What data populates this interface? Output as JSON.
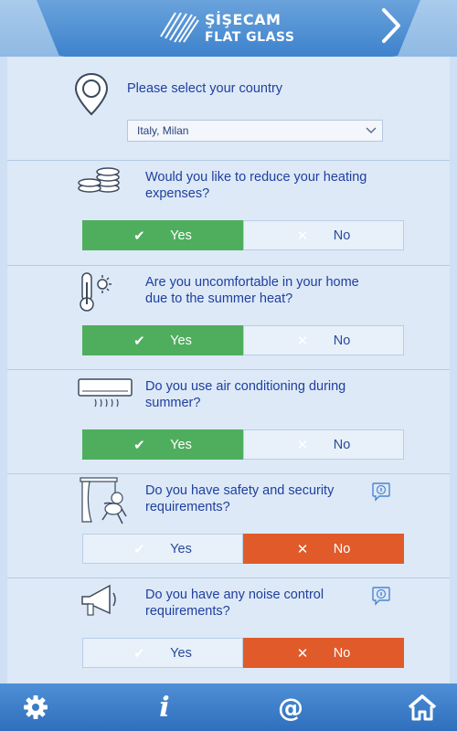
{
  "header": {
    "brand_line1": "ŞİŞECAM",
    "brand_line2": "FLAT GLASS",
    "logo_icon": "sisecam-logo-icon",
    "next_icon": "chevron-right-icon"
  },
  "country": {
    "label": "Please select your country",
    "selected": "Italy, Milan",
    "icon": "location-pin-icon"
  },
  "questions": [
    {
      "text": "Would you like to reduce your heating expenses?",
      "icon": "coins-icon",
      "yes": "Yes",
      "no": "No",
      "answer": "yes",
      "info": false
    },
    {
      "text": "Are you uncomfortable in your home due to the summer heat?",
      "icon": "thermometer-sun-icon",
      "yes": "Yes",
      "no": "No",
      "answer": "yes",
      "info": false
    },
    {
      "text": "Do you use air conditioning during summer?",
      "icon": "air-conditioner-icon",
      "yes": "Yes",
      "no": "No",
      "answer": "yes",
      "info": false
    },
    {
      "text": "Do you have safety and security requirements?",
      "icon": "burglar-window-icon",
      "yes": "Yes",
      "no": "No",
      "answer": "no",
      "info": true
    },
    {
      "text": "Do you have any noise control requirements?",
      "icon": "megaphone-icon",
      "yes": "Yes",
      "no": "No",
      "answer": "no",
      "info": true
    }
  ],
  "footer": {
    "info_glyph": "i",
    "email_glyph": "@",
    "items": [
      "settings-gear-icon",
      "info-icon",
      "email-at-icon",
      "home-icon"
    ]
  },
  "colors": {
    "yes_active": "#4fae5e",
    "no_active": "#e05a2a",
    "text": "#1f3f9e",
    "header": "#3d82cc"
  }
}
